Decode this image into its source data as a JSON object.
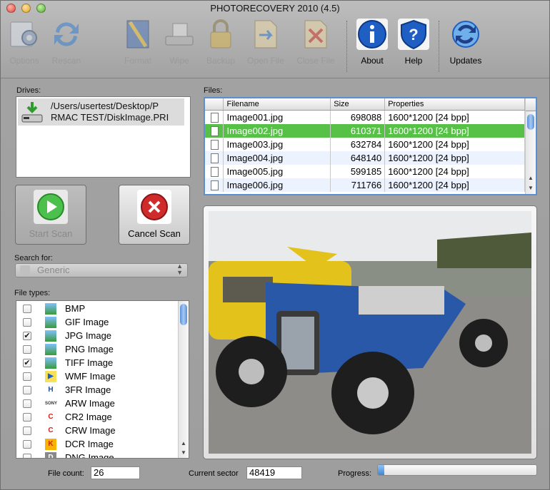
{
  "window": {
    "title": "PHOTORECOVERY 2010 (4.5)"
  },
  "toolbar": [
    {
      "label": "Options",
      "icon": "options-gear-icon",
      "enabled": false
    },
    {
      "label": "Rescan",
      "icon": "rescan-arrows-icon",
      "enabled": false
    },
    {
      "label": "Format",
      "icon": "format-disk-icon",
      "enabled": false
    },
    {
      "label": "Wipe",
      "icon": "wipe-drive-icon",
      "enabled": false
    },
    {
      "label": "Backup",
      "icon": "backup-lock-icon",
      "enabled": false
    },
    {
      "label": "Open File",
      "icon": "open-file-icon",
      "enabled": false
    },
    {
      "label": "Close File",
      "icon": "close-file-icon",
      "enabled": false
    },
    {
      "label": "About",
      "icon": "about-info-icon",
      "enabled": true
    },
    {
      "label": "Help",
      "icon": "help-shield-icon",
      "enabled": true
    },
    {
      "label": "Updates",
      "icon": "updates-globe-icon",
      "enabled": true
    }
  ],
  "drives": {
    "label": "Drives:",
    "items": [
      {
        "path_line1": "/Users/usertest/Desktop/P",
        "path_line2": "RMAC TEST/DiskImage.PRI"
      }
    ]
  },
  "buttons": {
    "start_scan": "Start Scan",
    "cancel_scan": "Cancel Scan"
  },
  "search": {
    "label": "Search for:",
    "value": "Generic"
  },
  "file_types": {
    "label": "File types:",
    "items": [
      {
        "name": "BMP",
        "checked": false,
        "icon": "image-icon"
      },
      {
        "name": "GIF Image",
        "checked": false,
        "icon": "image-icon"
      },
      {
        "name": "JPG Image",
        "checked": true,
        "icon": "image-icon"
      },
      {
        "name": "PNG Image",
        "checked": false,
        "icon": "image-icon"
      },
      {
        "name": "TIFF Image",
        "checked": true,
        "icon": "image-icon"
      },
      {
        "name": "WMF Image",
        "checked": false,
        "icon": "wmf-icon"
      },
      {
        "name": "3FR Image",
        "checked": false,
        "icon": "hasselblad-icon"
      },
      {
        "name": "ARW Image",
        "checked": false,
        "icon": "sony-icon"
      },
      {
        "name": "CR2 Image",
        "checked": false,
        "icon": "canon-icon"
      },
      {
        "name": "CRW Image",
        "checked": false,
        "icon": "canon-icon"
      },
      {
        "name": "DCR Image",
        "checked": false,
        "icon": "kodak-icon"
      },
      {
        "name": "DNG Image",
        "checked": false,
        "icon": "dng-icon"
      }
    ]
  },
  "files": {
    "label": "Files:",
    "columns": [
      "Filename",
      "Size",
      "Properties"
    ],
    "rows": [
      {
        "filename": "Image001.jpg",
        "size": "698088",
        "properties": "1600*1200 [24 bpp]"
      },
      {
        "filename": "Image002.jpg",
        "size": "610371",
        "properties": "1600*1200 [24 bpp]",
        "selected": true
      },
      {
        "filename": "Image003.jpg",
        "size": "632784",
        "properties": "1600*1200 [24 bpp]"
      },
      {
        "filename": "Image004.jpg",
        "size": "648140",
        "properties": "1600*1200 [24 bpp]"
      },
      {
        "filename": "Image005.jpg",
        "size": "599185",
        "properties": "1600*1200 [24 bpp]"
      },
      {
        "filename": "Image006.jpg",
        "size": "711766",
        "properties": "1600*1200 [24 bpp]"
      }
    ]
  },
  "status": {
    "file_count_label": "File count:",
    "file_count": "26",
    "current_sector_label": "Current sector",
    "current_sector": "48419",
    "progress_label": "Progress:",
    "progress": 0.04
  },
  "colors": {
    "selection": "#56c047",
    "accent": "#3d86d8"
  }
}
